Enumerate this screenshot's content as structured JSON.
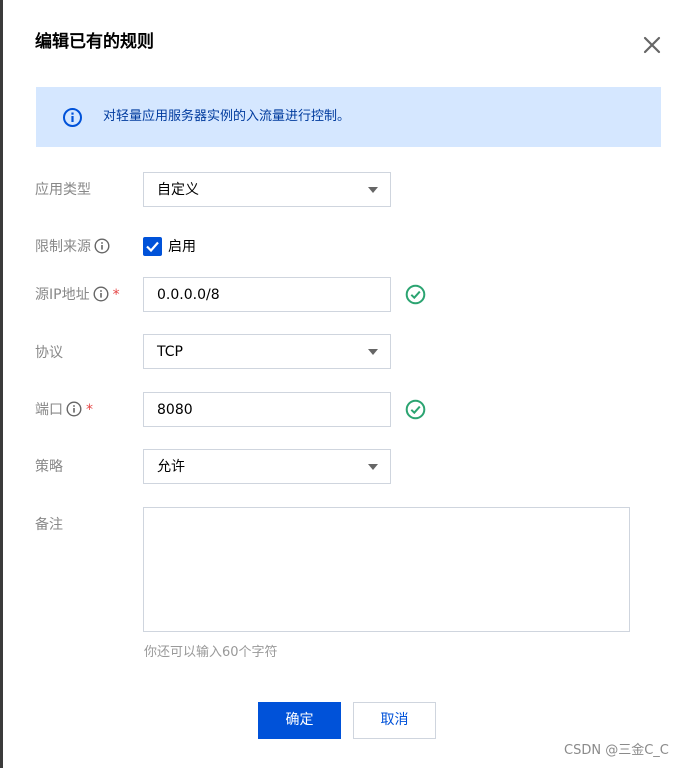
{
  "dialog": {
    "title": "编辑已有的规则",
    "notice": "对轻量应用服务器实例的入流量进行控制。"
  },
  "form": {
    "app_type": {
      "label": "应用类型",
      "value": "自定义"
    },
    "limit_source": {
      "label": "限制来源",
      "checkbox_label": "启用",
      "checked": true
    },
    "source_ip": {
      "label": "源IP地址",
      "required_mark": "*",
      "value": "0.0.0.0/8"
    },
    "protocol": {
      "label": "协议",
      "value": "TCP"
    },
    "port": {
      "label": "端口",
      "required_mark": "*",
      "value": "8080"
    },
    "policy": {
      "label": "策略",
      "value": "允许"
    },
    "remark": {
      "label": "备注",
      "value": "",
      "hint": "你还可以输入60个字符"
    }
  },
  "buttons": {
    "confirm": "确定",
    "cancel": "取消"
  },
  "watermark": "CSDN @三金C_C",
  "colors": {
    "primary": "#0052d9",
    "notice_bg": "#d5e7ff",
    "notice_text": "#003b9e",
    "success": "#2ba471",
    "required": "#e54545"
  },
  "icons": {
    "close": "close-icon",
    "notice": "info-circle-icon",
    "field_help": "info-circle-icon",
    "valid": "check-circle-icon",
    "dropdown": "caret-down-icon"
  }
}
